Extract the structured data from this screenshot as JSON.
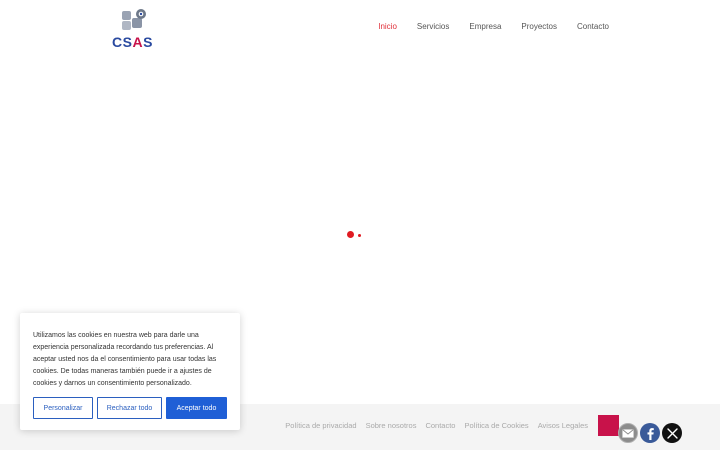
{
  "header": {
    "logo_text": "CSAS",
    "nav": [
      {
        "label": "Inicio",
        "active": true
      },
      {
        "label": "Servicios",
        "active": false
      },
      {
        "label": "Empresa",
        "active": false
      },
      {
        "label": "Proyectos",
        "active": false
      },
      {
        "label": "Contacto",
        "active": false
      }
    ]
  },
  "cookie_banner": {
    "text": "Utilizamos las cookies en nuestra web para darle una experiencia personalizada recordando tus preferencias. Al aceptar usted nos da el consentimiento para usar todas las cookies. De todas maneras también puede ir a ajustes de cookies y darnos un consentimiento personalizado.",
    "customize_label": "Personalizar",
    "reject_label": "Rechazar todo",
    "accept_label": "Aceptar todo"
  },
  "footer": {
    "links": [
      "Política de privacidad",
      "Sobre nosotros",
      "Contacto",
      "Política de Cookies",
      "Avisos Legales"
    ]
  },
  "social": {
    "icons": [
      "email-icon",
      "facebook-icon",
      "x-twitter-icon"
    ]
  },
  "colors": {
    "brand_red": "#c8124a",
    "brand_blue": "#2a4aa0",
    "nav_active": "#e0303a",
    "button_blue": "#1f5fd6"
  }
}
